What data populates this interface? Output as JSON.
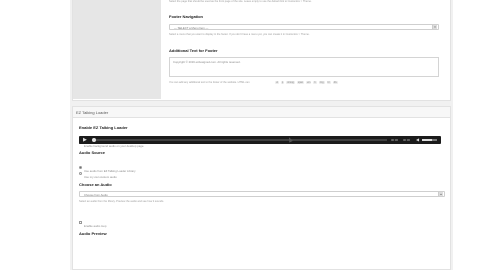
{
  "top": {
    "line1": "Select the page that should be used as the front page of the site. Leave empty to use the default link to Customize > Theme.",
    "footer_nav_label": "Footer Navigation",
    "footer_nav_value": "— SELECT a Menu Item —",
    "footer_nav_help": "Select a menu that you want to display in the footer. If you don't have a menu yet, you can create it in Customize > Theme.",
    "additional_text_label": "Additional Text for Footer",
    "footer_text_value": "Copyright © 2016 ezdesigned.com. All rights reserved.",
    "footer_text_help": "You can add any additional text to the footer of the website. HTML can",
    "tags": [
      "ul",
      "p",
      "strong",
      "span",
      "em",
      "b",
      "img",
      "br",
      "div"
    ]
  },
  "panel": {
    "title": "EZ Talking Loader",
    "enable_label": "Enable EZ Talking Loader",
    "enable_desc": "Enable background audio on your desktop page.",
    "audio_source_label": "Audio Source",
    "source_options": [
      "Use audio from EZ Talking Loader Library",
      "Use my own custom audio"
    ],
    "choose_label": "Choose an Audio",
    "choose_value": "Choose from Audio",
    "choose_help": "Select an audio from the library. Preview the audio and see how it sounds.",
    "autoplay_label": "Enable audio loop",
    "preview_label": "Audio Preview",
    "time_current": "00:00",
    "time_total": "00:00"
  }
}
